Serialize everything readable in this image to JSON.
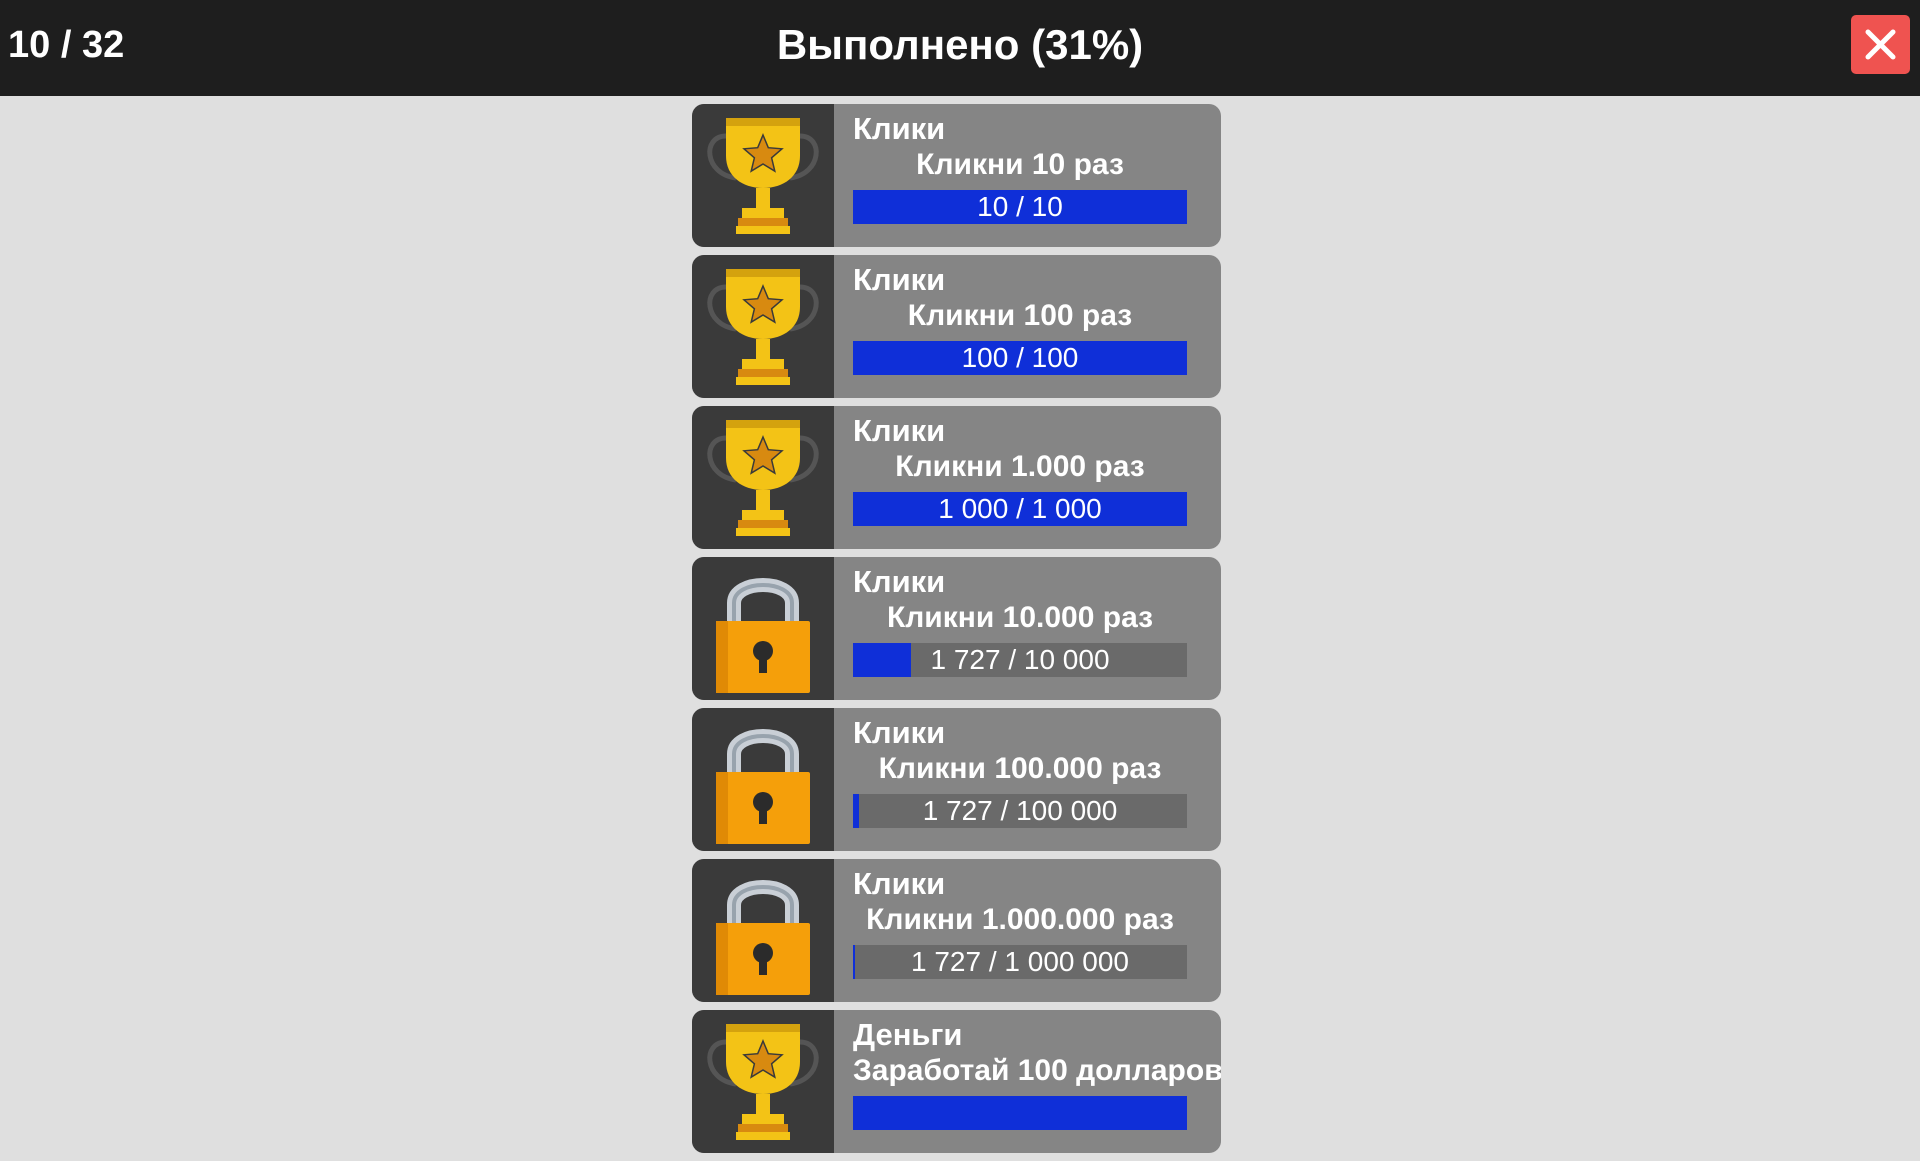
{
  "header": {
    "counter": "10 / 32",
    "title": "Выполнено (31%)",
    "close_icon": "close-icon"
  },
  "colors": {
    "header_bg": "#1e1e1e",
    "close_bg": "#ef5350",
    "card_bg": "#858585",
    "icon_bg": "#3a3a3a",
    "progress_fill": "#0f2fd8",
    "progress_track": "#6a6a6a"
  },
  "achievements": [
    {
      "icon": "trophy-icon",
      "category": "Клики",
      "description": "Кликни 10 раз",
      "progress_text": "10 / 10",
      "progress": 1.0
    },
    {
      "icon": "trophy-icon",
      "category": "Клики",
      "description": "Кликни 100 раз",
      "progress_text": "100 / 100",
      "progress": 1.0
    },
    {
      "icon": "trophy-icon",
      "category": "Клики",
      "description": "Кликни 1.000 раз",
      "progress_text": "1 000 / 1 000",
      "progress": 1.0
    },
    {
      "icon": "padlock-icon",
      "category": "Клики",
      "description": "Кликни 10.000 раз",
      "progress_text": "1 727 / 10 000",
      "progress": 0.1727
    },
    {
      "icon": "padlock-icon",
      "category": "Клики",
      "description": "Кликни 100.000 раз",
      "progress_text": "1 727 / 100 000",
      "progress": 0.01727
    },
    {
      "icon": "padlock-icon",
      "category": "Клики",
      "description": "Кликни 1.000.000 раз",
      "progress_text": "1 727 / 1 000 000",
      "progress": 0.001727
    },
    {
      "icon": "trophy-icon",
      "category": "Деньги",
      "description": "Заработай 100 долларов",
      "progress_text": "",
      "progress": 1.0
    }
  ]
}
